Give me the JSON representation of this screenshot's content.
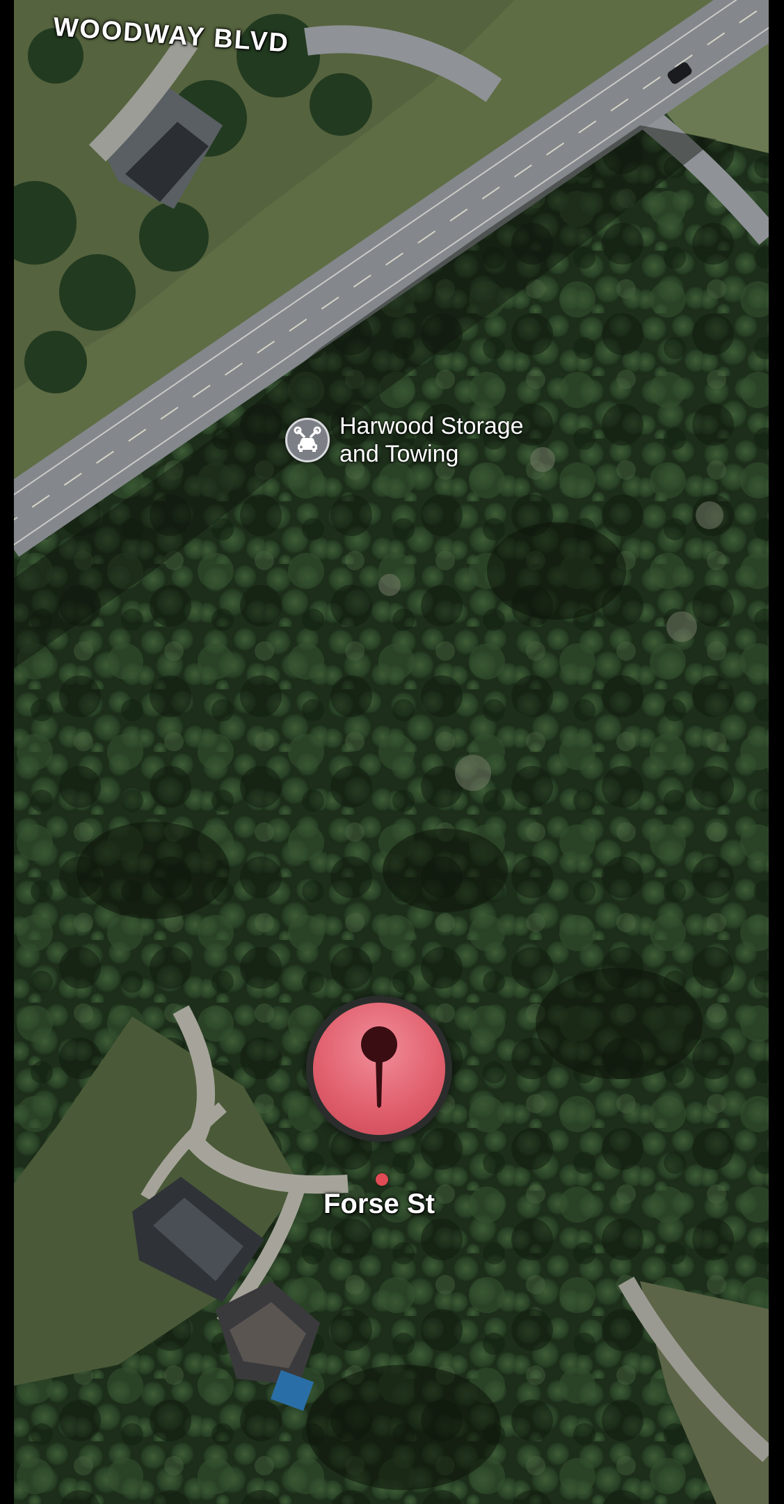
{
  "map": {
    "view": "satellite",
    "roads": [
      {
        "name": "WOODWAY BLVD",
        "label_style": "uppercase-major"
      }
    ],
    "poi": {
      "name_line1": "Harwood Storage",
      "name_line2": "and Towing",
      "icon": "car-service-icon",
      "icon_color": "#7c7f86"
    },
    "dropped_pin": {
      "label": "Forse St",
      "icon": "location-pin-icon",
      "color": "#e2616f"
    }
  },
  "colors": {
    "forest_dark": "#1a2a19",
    "forest_mid": "#2f4a2c",
    "road": "#8b8f93",
    "grass": "#6f7d52"
  }
}
